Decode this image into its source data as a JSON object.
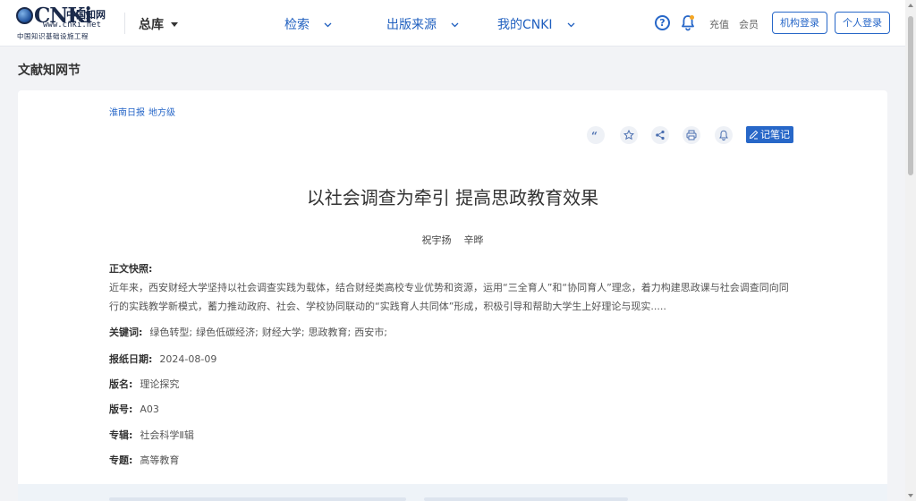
{
  "header": {
    "logo_mark": "CNKi",
    "logo_cn": "中国知网",
    "logo_url": "www.cnki.net",
    "logo_sub": "中国知识基础设施工程",
    "library": "总库",
    "nav": [
      "检索",
      "出版来源",
      "我的CNKI"
    ],
    "help_icon": "?",
    "recharge": "充值",
    "member": "会员",
    "org_login": "机构登录",
    "personal_login": "个人登录",
    "accent": "#2767c8"
  },
  "page": {
    "section_title": "文献知网节"
  },
  "article": {
    "source": "淮南日报",
    "level": "地方级",
    "note_label": "记笔记",
    "title": "以社会调查为牵引 提高思政教育效果",
    "authors": [
      "祝宇扬",
      "辛晔"
    ],
    "abstract_label": "正文快照:",
    "abstract": "近年来，西安财经大学坚持以社会调查实践为载体，结合财经类高校专业优势和资源，运用“三全育人”和“协同育人”理念，着力构建思政课与社会调查同向同行的实践教学新模式，蓄力推动政府、社会、学校协同联动的“实践育人共同体”形成，积极引导和帮助大学生上好理论与现实.....",
    "keywords_label": "关键词:",
    "keywords": [
      "绿色转型;",
      "绿色低碳经济;",
      "财经大学;",
      "思政教育;",
      "西安市;"
    ],
    "date_label": "报纸日期:",
    "date": "2024-08-09",
    "edition_name_label": "版名:",
    "edition_name": "理论探究",
    "edition_no_label": "版号:",
    "edition_no": "A03",
    "series_label": "专辑:",
    "series": "社会科学Ⅱ辑",
    "topic_label": "专题:",
    "topic": "高等教育"
  }
}
